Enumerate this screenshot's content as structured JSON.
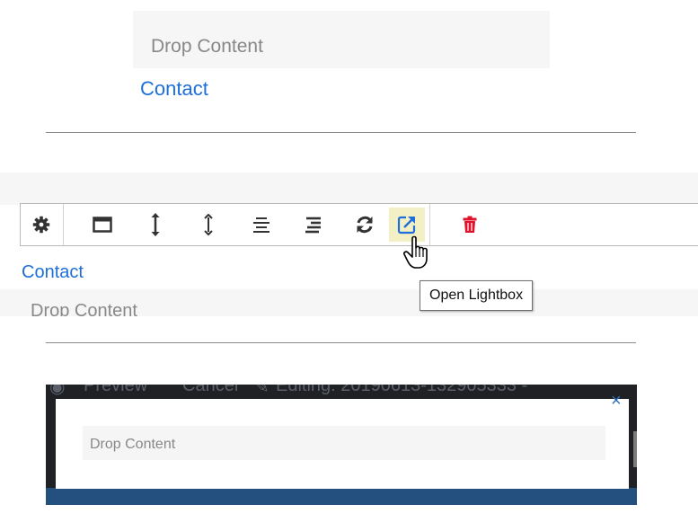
{
  "panel1": {
    "drop_text": "Drop Content",
    "link_text": "Contact"
  },
  "panel2": {
    "toolbar": {
      "buttons": [
        {
          "name": "settings",
          "icon": "gear-icon"
        },
        {
          "name": "layout",
          "icon": "window-icon"
        },
        {
          "name": "height",
          "icon": "resize-vertical-icon"
        },
        {
          "name": "spacing",
          "icon": "vertical-spacing-icon"
        },
        {
          "name": "align",
          "icon": "align-center-icon"
        },
        {
          "name": "text-align",
          "icon": "align-right-icon"
        },
        {
          "name": "refresh",
          "icon": "refresh-icon"
        },
        {
          "name": "open-lightbox",
          "icon": "external-link-icon",
          "active": true
        },
        {
          "name": "delete",
          "icon": "trash-icon"
        }
      ]
    },
    "tooltip": "Open Lightbox",
    "link_text": "Contact",
    "drop_text": "Drop Content"
  },
  "panel3": {
    "topbar": {
      "preview": "Preview",
      "cancel": "Cancel",
      "editing": "Editing:  20190613-132905333 -"
    },
    "close_glyph": "×",
    "drop_text": "Drop Content"
  },
  "colors": {
    "link": "#1e6fd9",
    "delete": "#e0112b",
    "dark_bg": "#1f2124",
    "blue_bar": "#23507f",
    "active_button": "#f2f0c4"
  }
}
